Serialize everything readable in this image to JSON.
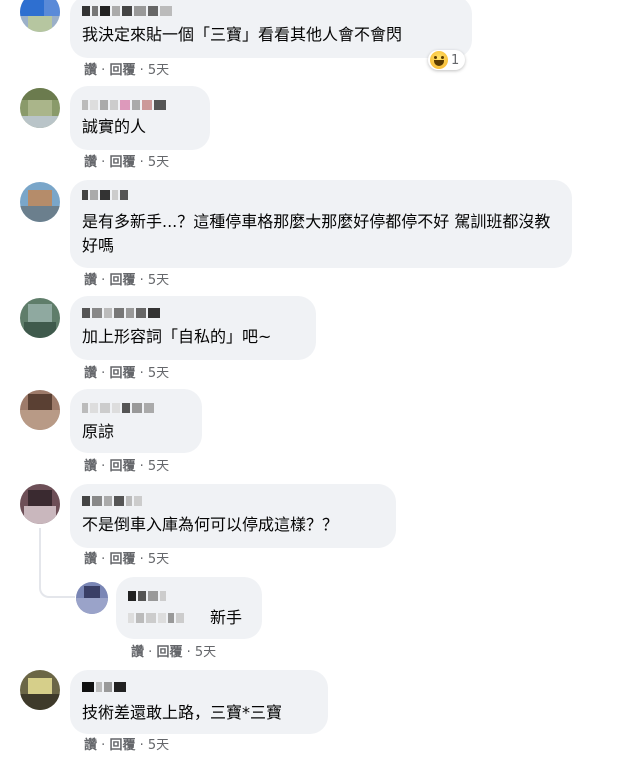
{
  "comments": [
    {
      "text": "我決定來貼一個「三寶」看看其他人會不會閃",
      "reaction": {
        "icon": "haha-emoji-icon",
        "count": "1"
      }
    },
    {
      "text": "誠實的人"
    },
    {
      "text": "是有多新手...？這種停車格那麼大那麼好停都停不好 駕訓班都沒教好嗎"
    },
    {
      "text": "加上形容詞「自私的」吧~"
    },
    {
      "text": "原諒"
    },
    {
      "text": "不是倒車入庫為何可以停成這樣？？"
    },
    {
      "text": "新手",
      "reply": true
    },
    {
      "text": "技術差還敢上路，三寶*三寶"
    }
  ],
  "actions": {
    "like": "讚",
    "sep": "·",
    "reply": "回覆",
    "time": "5天"
  },
  "colors": {
    "bubble": "#f0f2f5",
    "meta": "#65676b",
    "text": "#050505"
  }
}
